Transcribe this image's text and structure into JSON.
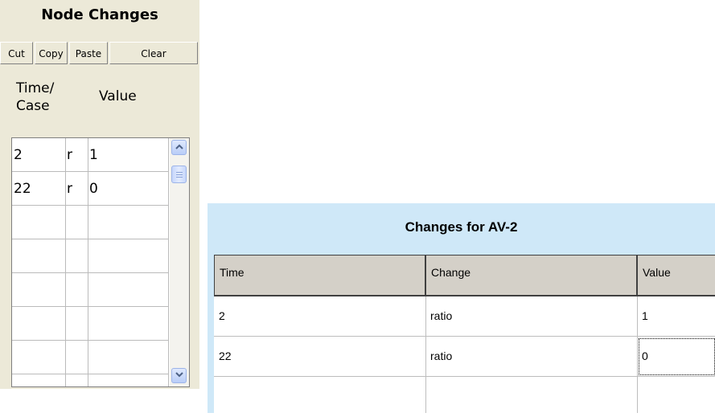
{
  "node_changes": {
    "title": "Node Changes",
    "buttons": {
      "cut": "Cut",
      "copy": "Copy",
      "paste": "Paste",
      "clear": "Clear"
    },
    "header": {
      "time": "Time/",
      "case": "Case",
      "value": "Value"
    },
    "rows": [
      {
        "time": "2",
        "flag": "r",
        "value": "1"
      },
      {
        "time": "22",
        "flag": "r",
        "value": "0"
      },
      {
        "time": "",
        "flag": "",
        "value": ""
      },
      {
        "time": "",
        "flag": "",
        "value": ""
      },
      {
        "time": "",
        "flag": "",
        "value": ""
      },
      {
        "time": "",
        "flag": "",
        "value": ""
      },
      {
        "time": "",
        "flag": "",
        "value": ""
      }
    ]
  },
  "changes_for": {
    "title": "Changes for  AV-2",
    "columns": {
      "time": "Time",
      "change": "Change",
      "value": "Value"
    },
    "rows": [
      {
        "time": "2",
        "change": "ratio",
        "value": "1"
      },
      {
        "time": "22",
        "change": "ratio",
        "value": "0"
      },
      {
        "time": "",
        "change": "",
        "value": ""
      }
    ]
  },
  "colors": {
    "left_panel_bg": "#ece9d8",
    "right_panel_bg": "#cfe8f8",
    "header_bg": "#d4d0c8",
    "scrollbar_accent": "#9db4e8"
  },
  "icons": {
    "scroll_up": "chevron-up-icon",
    "scroll_down": "chevron-down-icon"
  }
}
